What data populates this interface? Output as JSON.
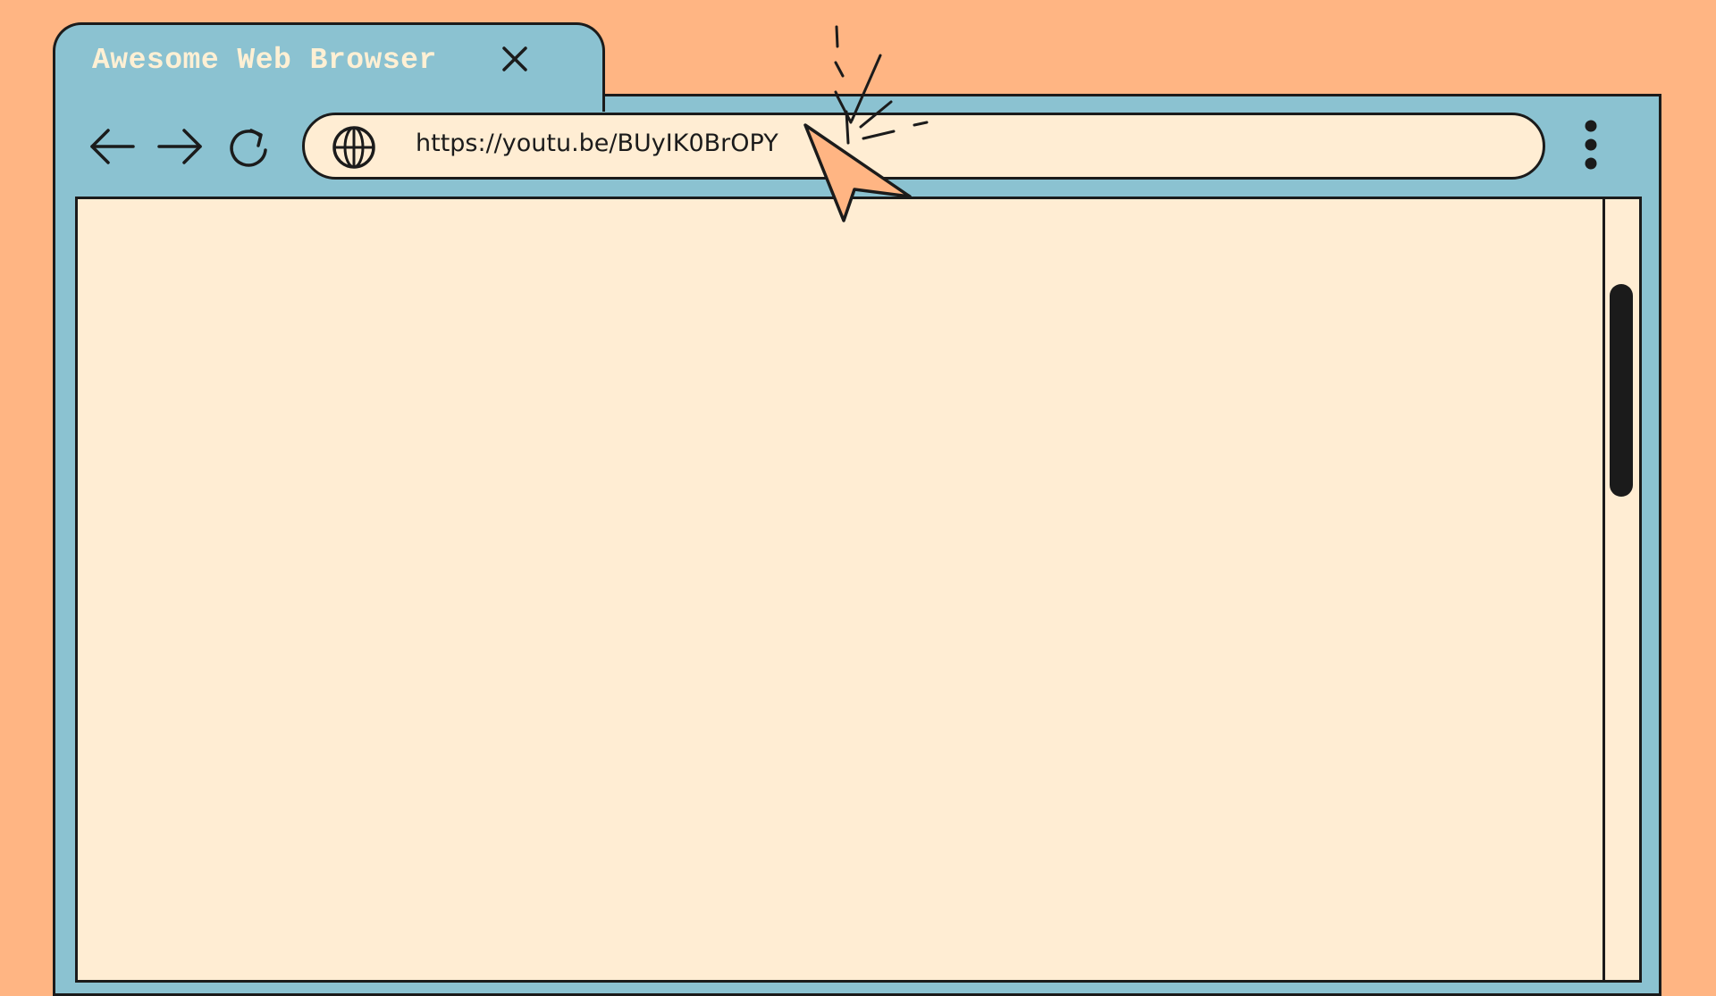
{
  "window": {
    "tab_title": "Awesome Web Browser"
  },
  "toolbar": {
    "back": "back-arrow-icon",
    "forward": "forward-arrow-icon",
    "reload": "reload-icon",
    "menu": "vertical-dots-icon"
  },
  "address_bar": {
    "icon": "globe-icon",
    "url": "https://youtu.be/BUyIK0BrOPY"
  },
  "colors": {
    "background": "#FFB583",
    "window": "#8BC2D1",
    "content": "#FFEDD3",
    "outline": "#1B1B1B",
    "tab_text": "#FFF0D4",
    "cursor": "#FFB583"
  }
}
